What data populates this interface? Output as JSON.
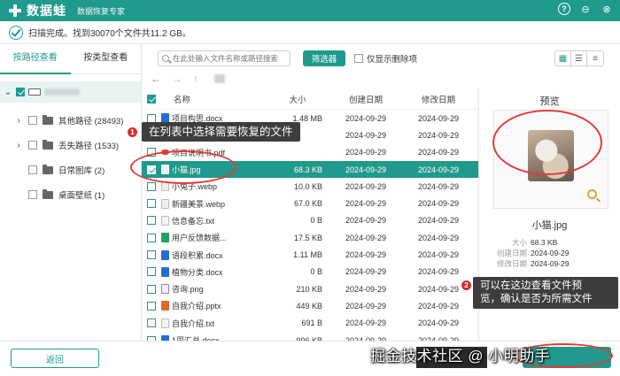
{
  "app": {
    "name": "数据蛙",
    "subtitle": "数据恢复专家"
  },
  "status": {
    "text": "扫描完成。找到30070个文件共11.2 GB。"
  },
  "sidebar": {
    "tabs": [
      {
        "label": "按路径查看",
        "active": true
      },
      {
        "label": "按类型查看",
        "active": false
      }
    ],
    "items": [
      {
        "label": "其他路径 (28493)",
        "expandable": true
      },
      {
        "label": "丢失路径 (1533)",
        "expandable": true
      },
      {
        "label": "日常图库 (2)",
        "expandable": false
      },
      {
        "label": "桌面壁纸 (1)",
        "expandable": false
      }
    ]
  },
  "toolbar": {
    "search_placeholder": "在此处输入文件名称或路径搜索",
    "filter_label": "筛选器",
    "only_deleted_label": "仅显示删除项"
  },
  "table": {
    "headers": {
      "name": "名称",
      "size": "大小",
      "created": "创建日期",
      "modified": "修改日期"
    },
    "rows": [
      {
        "name": "项目构思.docx",
        "type": "docx",
        "size": "1.48 MB",
        "created": "2024-09-29",
        "modified": "2024-09-29",
        "checked": false,
        "selected": false
      },
      {
        "name": "",
        "type": "docx",
        "size": "",
        "created": "2024-09-29",
        "modified": "2024-09-29",
        "checked": false,
        "selected": false
      },
      {
        "name": "项目说明书.pdf",
        "type": "pdf",
        "size": "",
        "created": "2024-09-29",
        "modified": "2024-09-29",
        "checked": false,
        "selected": false
      },
      {
        "name": "小猫.jpg",
        "type": "jpg",
        "size": "68.3 KB",
        "created": "2024-09-29",
        "modified": "2024-09-29",
        "checked": true,
        "selected": true
      },
      {
        "name": "小兔子.webp",
        "type": "webp",
        "size": "10.0 KB",
        "created": "2024-09-29",
        "modified": "2024-09-29",
        "checked": false,
        "selected": false
      },
      {
        "name": "新疆美景.webp",
        "type": "webp",
        "size": "67.0 KB",
        "created": "2024-09-29",
        "modified": "2024-09-29",
        "checked": false,
        "selected": false
      },
      {
        "name": "信息备忘.txt",
        "type": "txt",
        "size": "0 B",
        "created": "2024-09-29",
        "modified": "2024-09-29",
        "checked": false,
        "selected": false
      },
      {
        "name": "用户反馈数据...",
        "type": "xlsx",
        "size": "17.5 KB",
        "created": "2024-09-29",
        "modified": "2024-09-29",
        "checked": false,
        "selected": false
      },
      {
        "name": "语段积累.docx",
        "type": "docx",
        "size": "1.11 MB",
        "created": "2024-09-29",
        "modified": "2024-09-29",
        "checked": false,
        "selected": false
      },
      {
        "name": "植物分类.docx",
        "type": "docx",
        "size": "0 B",
        "created": "2024-09-29",
        "modified": "2024-09-29",
        "checked": false,
        "selected": false
      },
      {
        "name": "咨询.png",
        "type": "png",
        "size": "210 KB",
        "created": "2024-09-29",
        "modified": "2024-09-29",
        "checked": false,
        "selected": false
      },
      {
        "name": "自我介绍.pptx",
        "type": "pptx",
        "size": "449 KB",
        "created": "2024-09-29",
        "modified": "2024-09-29",
        "checked": false,
        "selected": false
      },
      {
        "name": "自我介绍.txt",
        "type": "txt",
        "size": "691 B",
        "created": "2024-09-29",
        "modified": "2024-09-29",
        "checked": false,
        "selected": false
      },
      {
        "name": "1周汇总.docx",
        "type": "docx",
        "size": "996 KB",
        "created": "2024-09-29",
        "modified": "2024-09-29",
        "checked": false,
        "selected": false
      }
    ]
  },
  "preview": {
    "title": "预览",
    "filename": "小猫.jpg",
    "size_label": "大小",
    "size_value": "68.3 KB",
    "created_label": "创建日期",
    "created_value": "2024-09-29",
    "modified_label": "修改日期",
    "modified_value": "2024-09-29"
  },
  "callouts": {
    "c1_num": "1",
    "c1_text": "在列表中选择需要恢复的文件",
    "c2_num": "2",
    "c2_line1": "可以在这边查看文件预",
    "c2_line2": "览，确认是否为所需文件"
  },
  "footer": {
    "back_label": "返回"
  },
  "watermark": "掘金技术社区 @ 小明助手",
  "colors": {
    "accent": "#1f9a8c",
    "annotation": "#e53935"
  }
}
